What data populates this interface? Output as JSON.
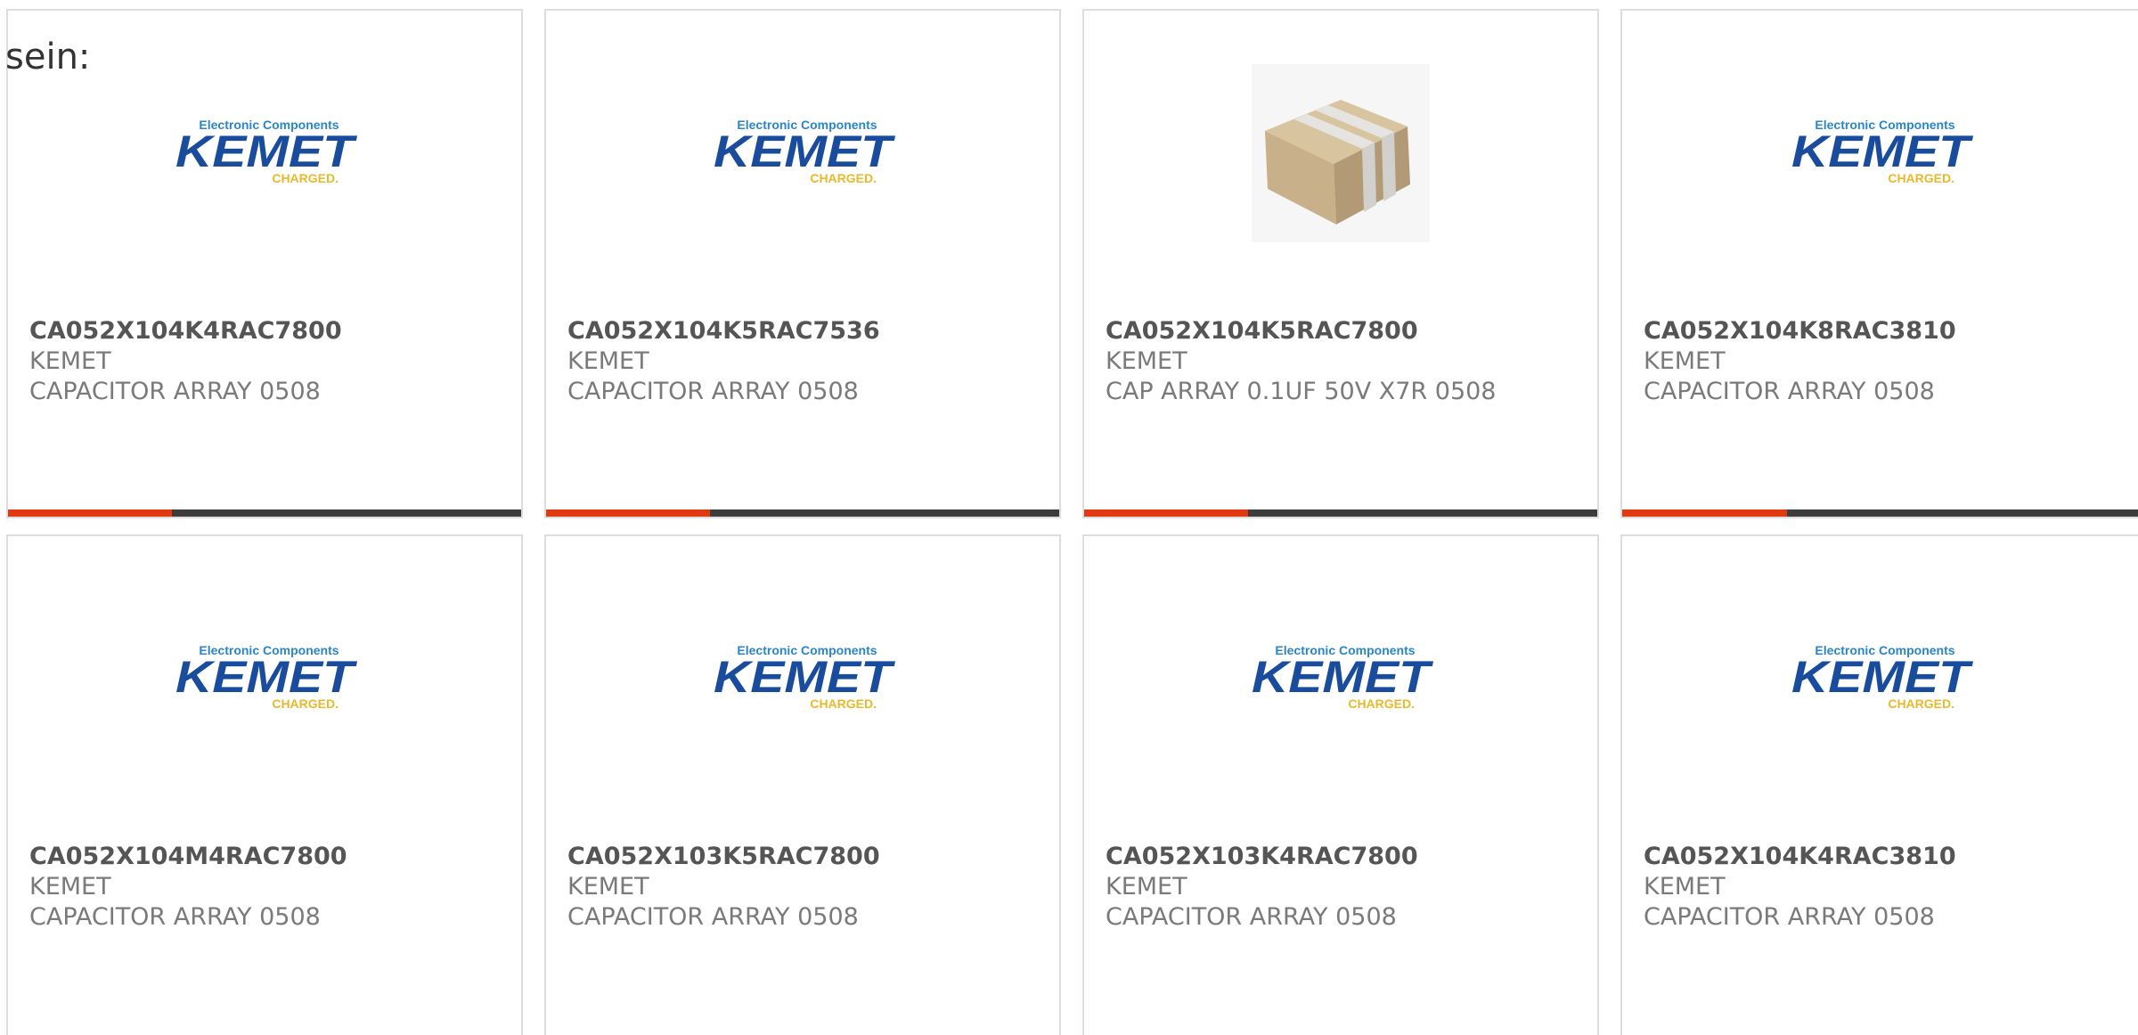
{
  "intro_text": "sein:",
  "colors": {
    "progress_accent": "#e03a12",
    "progress_track": "#3d3d3d",
    "card_border": "#dddddd",
    "kemet_blue": "#1a4c9e",
    "kemet_gold": "#e8b92a"
  },
  "logo": {
    "tagline": "Electronic Components",
    "brand": "KEMET",
    "slogan": "CHARGED."
  },
  "products": [
    {
      "part_number": "CA052X104K4RAC7800",
      "manufacturer": "KEMET",
      "description": "CAPACITOR ARRAY 0508",
      "image_type": "kemet-logo",
      "progress": 0.32
    },
    {
      "part_number": "CA052X104K5RAC7536",
      "manufacturer": "KEMET",
      "description": "CAPACITOR ARRAY 0508",
      "image_type": "kemet-logo",
      "progress": 0.32
    },
    {
      "part_number": "CA052X104K5RAC7800",
      "manufacturer": "KEMET",
      "description": "CAP ARRAY 0.1UF 50V X7R 0508",
      "image_type": "capacitor-photo",
      "progress": 0.32
    },
    {
      "part_number": "CA052X104K8RAC3810",
      "manufacturer": "KEMET",
      "description": "CAPACITOR ARRAY 0508",
      "image_type": "kemet-logo",
      "progress": 0.32
    },
    {
      "part_number": "CA052X104M4RAC7800",
      "manufacturer": "KEMET",
      "description": "CAPACITOR ARRAY 0508",
      "image_type": "kemet-logo"
    },
    {
      "part_number": "CA052X103K5RAC7800",
      "manufacturer": "KEMET",
      "description": "CAPACITOR ARRAY 0508",
      "image_type": "kemet-logo"
    },
    {
      "part_number": "CA052X103K4RAC7800",
      "manufacturer": "KEMET",
      "description": "CAPACITOR ARRAY 0508",
      "image_type": "kemet-logo"
    },
    {
      "part_number": "CA052X104K4RAC3810",
      "manufacturer": "KEMET",
      "description": "CAPACITOR ARRAY 0508",
      "image_type": "kemet-logo"
    }
  ]
}
